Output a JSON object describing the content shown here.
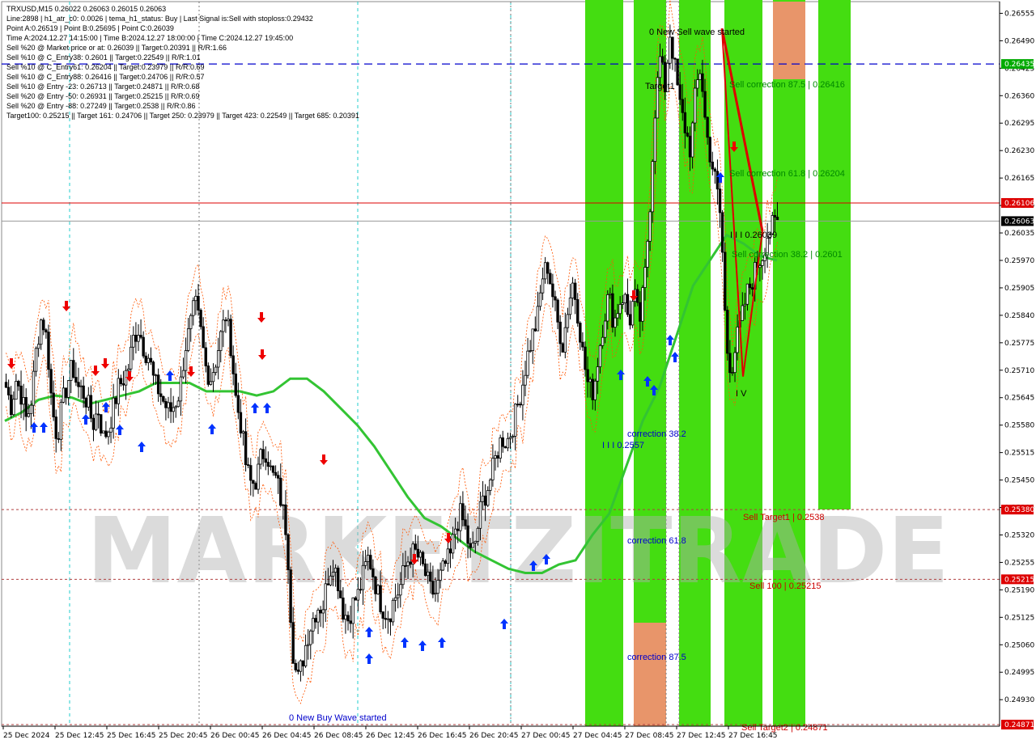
{
  "header": {
    "lines": [
      "TRXUSD,M15  0.26022 0.26063 0.26015 0.26063",
      "Line:2898  |  h1_atr_c0: 0.0026  |  tema_h1_status: Buy  |  Last Signal is:Sell with stoploss:0.29432",
      "Point A:0.26519  |  Point B:0.25695  |  Point C:0.26039",
      "Time A:2024.12.27 14:15:00  |  Time B:2024.12.27 18:00:00  |  Time C:2024.12.27 19:45:00",
      "Sell %20 @ Market price or at: 0.26039  ||  Target:0.20391  ||  R/R:1.66",
      "Sell %10 @ C_Entry38: 0.2601  ||  Target:0.22549  ||  R/R:1.01",
      "Sell %10 @ C_Entry61: 0.26204  ||  Target:0.23979  ||  R/R:0.69",
      "Sell %10 @ C_Entry88: 0.26416  ||  Target:0.24706  ||  R/R:0.57",
      "Sell %10 @ Entry -23: 0.26713  ||  Target:0.24871  ||  R/R:0.68",
      "Sell %20 @ Entry -50: 0.26931  ||  Target:0.25215  ||  R/R:0.69",
      "Sell %20 @ Entry -88: 0.27249  ||  Target:0.2538  ||  R/R:0.86",
      "Target100: 0.25215  ||  Target 161: 0.24706  ||  Target 250: 0.23979  ||  Target 423: 0.22549  ||  Target 685: 0.20391"
    ]
  },
  "watermark": "MARKETZITRADE",
  "annotations": {
    "sell_wave": "0 New Sell wave started",
    "buy_wave": "0 New Buy Wave started",
    "target1": "Target1",
    "sell_corr_875": "Sell correction 87.5 | 0.26416",
    "sell_corr_618": "Sell correction 61.8 | 0.26204",
    "sell_corr_382": "Sell correction 38.2 | 0.2601",
    "point_c_label": "I I I 0.26039",
    "point_b_label": "I V",
    "corr_382": "correction 38.2",
    "wave_iii": "I I I 0.2557",
    "corr_618": "correction 61.8",
    "corr_875": "correction 87.5",
    "sell_target1": "Sell Target1 | 0.2538",
    "sell_100": "Sell 100 | 0.25215",
    "sell_target2": "Sell Target2 | 0.24871"
  },
  "price_tags": {
    "line_a": "0.26435",
    "red": "0.26106",
    "current": "0.26063",
    "target1": "0.25380",
    "sell100": "0.25215",
    "target2": "0.24871"
  },
  "colors": {
    "bull": "#000000",
    "bear": "#000000",
    "ma": "#33c433",
    "zone_green": "#44dd11",
    "zone_orange": "#e8956a",
    "red_line": "#dd0000",
    "blue_dash": "#0000cc",
    "band": "#ff5500",
    "up_arrow": "#0033ff",
    "down_arrow": "#ee0000"
  },
  "chart_data": {
    "type": "candlestick",
    "symbol": "TRXUSD",
    "timeframe": "M15",
    "ylim": [
      0.24871,
      0.26575
    ],
    "y_ticks": [
      0.26555,
      0.2649,
      0.26425,
      0.2636,
      0.26295,
      0.2623,
      0.26165,
      0.261,
      0.26035,
      0.2597,
      0.25905,
      0.2584,
      0.25775,
      0.2571,
      0.25645,
      0.2558,
      0.25515,
      0.2545,
      0.25385,
      0.2532,
      0.25255,
      0.2519,
      0.25125,
      0.2506,
      0.24995,
      0.2493
    ],
    "y_tick_labels": [
      "0.26555",
      "0.26490",
      "0.26425",
      "0.26360",
      "0.26295",
      "0.26230",
      "0.26165",
      "0.26100",
      "0.26035",
      "0.25970",
      "0.25905",
      "0.25840",
      "0.25775",
      "0.25710",
      "0.25645",
      "0.25580",
      "0.25515",
      "0.25450",
      "0.25385",
      "0.25320",
      "0.25255",
      "0.25190",
      "0.25125",
      "0.25060",
      "0.24995",
      "0.24930"
    ],
    "x_labels": [
      "25 Dec 2024",
      "25 Dec 12:45",
      "25 Dec 16:45",
      "25 Dec 20:45",
      "26 Dec 00:45",
      "26 Dec 04:45",
      "26 Dec 08:45",
      "26 Dec 12:45",
      "26 Dec 16:45",
      "26 Dec 20:45",
      "27 Dec 00:45",
      "27 Dec 04:45",
      "27 Dec 08:45",
      "27 Dec 12:45",
      "27 Dec 16:45"
    ],
    "close_path": [
      0.2567,
      0.25625,
      0.2569,
      0.2565,
      0.2559,
      0.25645,
      0.2577,
      0.2584,
      0.2578,
      0.2562,
      0.2555,
      0.2563,
      0.2568,
      0.2572,
      0.2567,
      0.2566,
      0.2563,
      0.2558,
      0.2562,
      0.2555,
      0.2557,
      0.2562,
      0.2567,
      0.2569,
      0.2572,
      0.2579,
      0.2581,
      0.2576,
      0.2574,
      0.2568,
      0.2566,
      0.2563,
      0.2561,
      0.2563,
      0.2566,
      0.2576,
      0.2581,
      0.2587,
      0.2581,
      0.2572,
      0.2569,
      0.2573,
      0.2579,
      0.2584,
      0.2577,
      0.2564,
      0.2558,
      0.2548,
      0.2544,
      0.2545,
      0.2551,
      0.2552,
      0.2546,
      0.2545,
      0.2539,
      0.2532,
      0.2506,
      0.2497,
      0.2502,
      0.2508,
      0.2512,
      0.2515,
      0.2515,
      0.2522,
      0.2526,
      0.2521,
      0.2514,
      0.2512,
      0.2516,
      0.2518,
      0.2523,
      0.2527,
      0.2522,
      0.2517,
      0.2514,
      0.2513,
      0.2517,
      0.2519,
      0.2524,
      0.2527,
      0.2528,
      0.2526,
      0.2523,
      0.2519,
      0.2518,
      0.2522,
      0.2525,
      0.2527,
      0.2534,
      0.2537,
      0.2533,
      0.2527,
      0.2531,
      0.2539,
      0.2542,
      0.2546,
      0.2551,
      0.2555,
      0.2554,
      0.2557,
      0.2562,
      0.2567,
      0.2574,
      0.2579,
      0.2583,
      0.2593,
      0.2596,
      0.2589,
      0.2582,
      0.2577,
      0.2586,
      0.2592,
      0.2584,
      0.2574,
      0.2567,
      0.2566,
      0.2575,
      0.2583,
      0.2589,
      0.2582,
      0.2587,
      0.2589,
      0.2582,
      0.2589,
      0.2582,
      0.2592,
      0.2609,
      0.2632,
      0.2645,
      0.2638,
      0.2651,
      0.2642,
      0.2633,
      0.2628,
      0.2623,
      0.2637,
      0.2643,
      0.2628,
      0.2621,
      0.2615,
      0.2606,
      0.2577,
      0.2571,
      0.2578,
      0.2583,
      0.2589,
      0.2592,
      0.2596,
      0.2598,
      0.2603,
      0.2605,
      0.2606
    ],
    "ma_path": [
      0.2559,
      0.2561,
      0.2564,
      0.2565,
      0.25645,
      0.2563,
      0.2564,
      0.2565,
      0.2566,
      0.2568,
      0.2568,
      0.2568,
      0.2566,
      0.2566,
      0.2566,
      0.2565,
      0.2566,
      0.2569,
      0.2569,
      0.2566,
      0.2562,
      0.2558,
      0.2553,
      0.2547,
      0.2541,
      0.2536,
      0.2534,
      0.2531,
      0.2528,
      0.2526,
      0.2524,
      0.2523,
      0.2523,
      0.2525,
      0.2526,
      0.2532,
      0.2537,
      0.2548,
      0.2559,
      0.2567,
      0.2579,
      0.2591,
      0.2597,
      0.2603,
      0.2601,
      0.2598,
      0.2597
    ],
    "line_a": 0.26435,
    "red_line": 0.26106,
    "current_price": 0.26063,
    "target1": 0.2538,
    "sell100": 0.25215,
    "target2": 0.24871,
    "abc_points": {
      "A": 0.26519,
      "B": 0.25695,
      "C": 0.26039
    }
  }
}
